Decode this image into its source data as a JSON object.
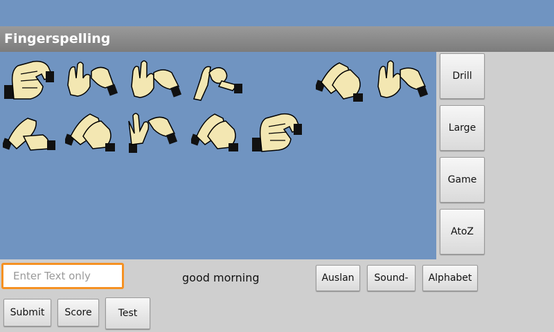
{
  "app": {
    "title": "Fingerspelling"
  },
  "phrase": "good morning",
  "input": {
    "placeholder": "Enter Text only",
    "value": ""
  },
  "side_buttons": [
    "Drill",
    "Large",
    "Game",
    "AtoZ"
  ],
  "bottom_buttons": {
    "auslan": "Auslan",
    "sound": "Sound-",
    "alphabet": "Alphabet",
    "submit": "Submit",
    "score": "Score",
    "test": "Test"
  },
  "colors": {
    "display_bg": "#7094c1",
    "skin": "#f3e7b2",
    "cuff": "#111111",
    "input_border": "#f59122"
  },
  "signs": {
    "row1": [
      "fingerspell-hand-sign",
      "fingerspell-hand-sign",
      "fingerspell-hand-sign",
      "fingerspell-hand-sign",
      "fingerspell-hand-sign",
      "fingerspell-hand-sign"
    ],
    "row2": [
      "fingerspell-hand-sign",
      "fingerspell-hand-sign",
      "fingerspell-hand-sign",
      "fingerspell-hand-sign",
      "fingerspell-hand-sign"
    ]
  }
}
